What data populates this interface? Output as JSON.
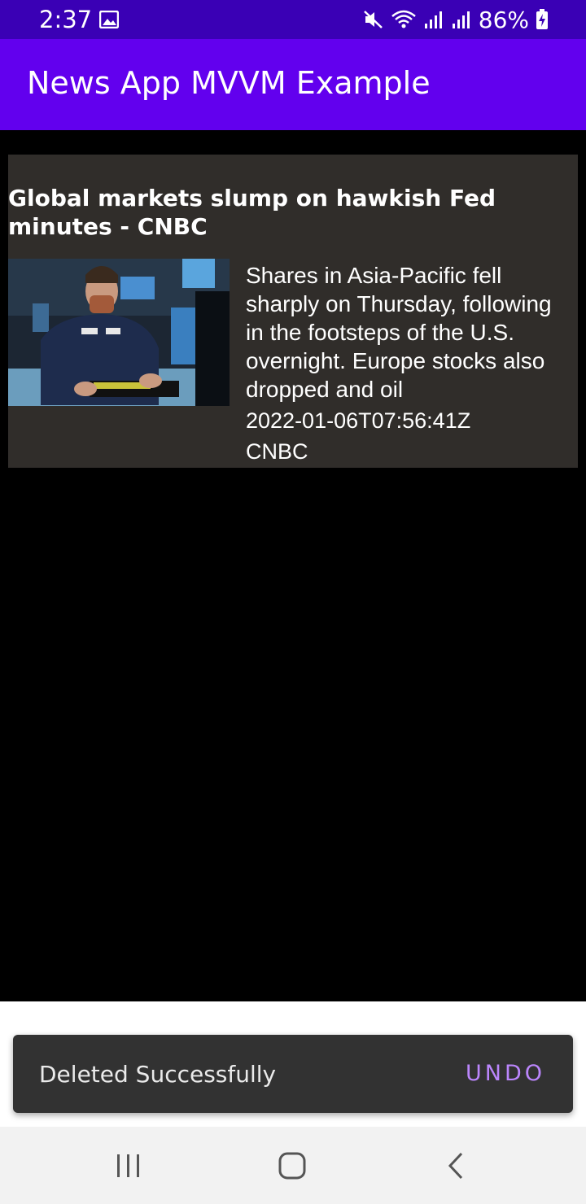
{
  "status_bar": {
    "time": "2:37",
    "battery": "86%",
    "icons": [
      "gallery-icon",
      "mute-icon",
      "wifi-icon",
      "signal-icon",
      "signal-icon",
      "battery-charging-icon"
    ],
    "background": "#3a00b5"
  },
  "app_bar": {
    "title": "News App MVVM Example",
    "background": "#6200ee"
  },
  "article": {
    "title": "Global markets slump on hawkish Fed minutes - CNBC",
    "description": "Shares in Asia-Pacific fell sharply on Thursday, following in the footsteps of the U.S. overnight. Europe stocks also dropped and oil",
    "published_at": "2022-01-06T07:56:41Z",
    "source": "CNBC",
    "image": "trader-photo",
    "card_background": "#302d2a"
  },
  "snackbar": {
    "message": "Deleted Successfully",
    "action": "UNDO",
    "action_color": "#bb86fc"
  },
  "nav_bar": {
    "buttons": [
      "recent-apps-icon",
      "home-icon",
      "back-icon"
    ]
  }
}
